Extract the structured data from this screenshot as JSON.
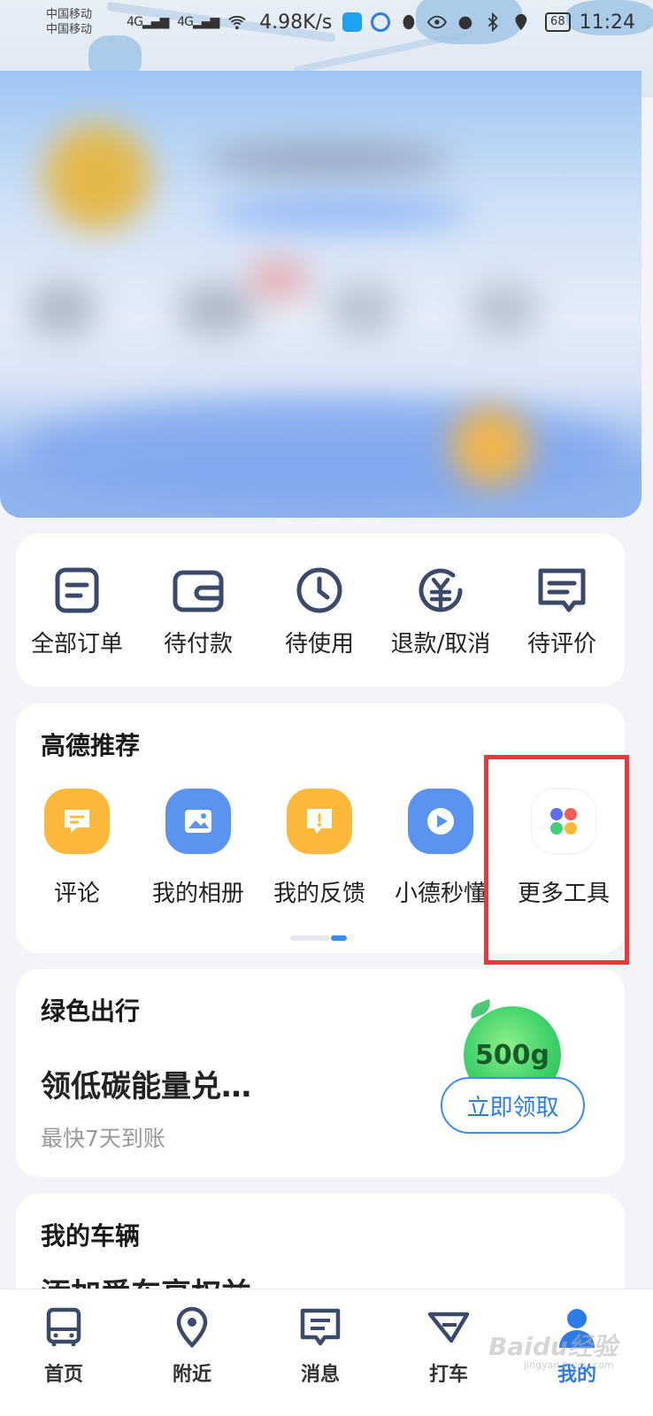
{
  "status_bar": {
    "carrier_1": "中国移动",
    "carrier_2": "中国移动",
    "signal": "4G",
    "speed": "4.98K/s",
    "battery": "68",
    "time": "11:24"
  },
  "orders": {
    "items": [
      {
        "label": "全部订单",
        "icon": "order-list-icon"
      },
      {
        "label": "待付款",
        "icon": "wallet-icon"
      },
      {
        "label": "待使用",
        "icon": "clock-icon"
      },
      {
        "label": "退款/取消",
        "icon": "refund-icon"
      },
      {
        "label": "待评价",
        "icon": "comment-icon"
      }
    ]
  },
  "recommend": {
    "title": "高德推荐",
    "items": [
      {
        "label": "评论",
        "icon": "comment-bubble-icon",
        "color": "#fbb83a"
      },
      {
        "label": "我的相册",
        "icon": "photo-album-icon",
        "color": "#5b93f0"
      },
      {
        "label": "我的反馈",
        "icon": "feedback-icon",
        "color": "#fbb83a"
      },
      {
        "label": "小德秒懂",
        "icon": "play-icon",
        "color": "#5b93f0"
      },
      {
        "label": "更多工具",
        "icon": "more-tools-icon",
        "color": "#ffffff"
      }
    ]
  },
  "green_travel": {
    "title": "绿色出行",
    "headline": "领低碳能量兑…",
    "subtitle": "最快7天到账",
    "badge": "500g",
    "button": "立即领取"
  },
  "vehicle": {
    "title": "我的车辆",
    "partial_text": "添加爱车享权益"
  },
  "bottom_nav": {
    "items": [
      {
        "label": "首页",
        "icon": "bus-icon"
      },
      {
        "label": "附近",
        "icon": "location-pin-icon"
      },
      {
        "label": "消息",
        "icon": "message-icon"
      },
      {
        "label": "打车",
        "icon": "taxi-icon"
      },
      {
        "label": "我的",
        "icon": "user-icon",
        "active": true
      }
    ]
  },
  "watermark": {
    "text": "Baidu经验",
    "sub": "jingyan.baidu.com"
  },
  "colors": {
    "accent": "#2d7be5",
    "highlight": "#e8383a",
    "icon_stroke": "#3b4a6b"
  }
}
